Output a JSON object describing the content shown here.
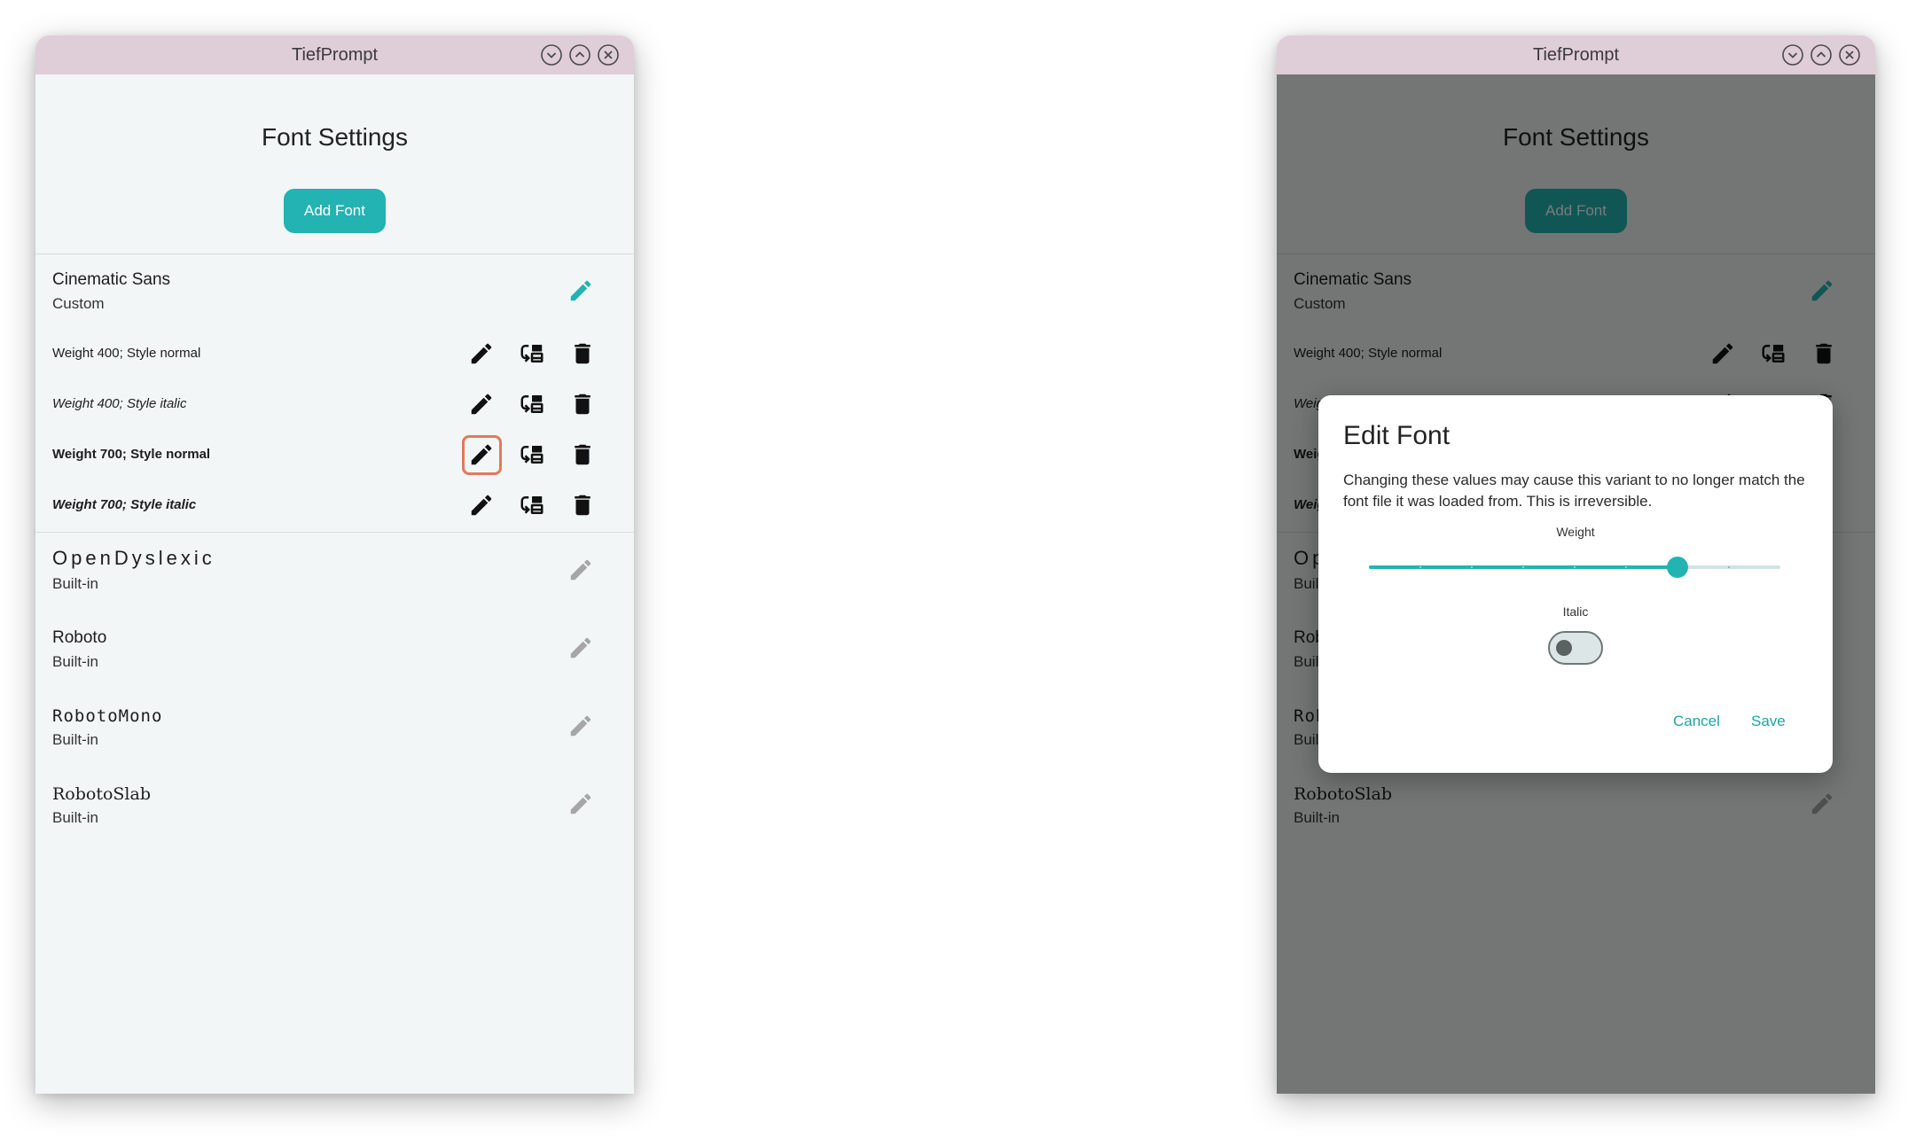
{
  "app_title": "TiefPrompt",
  "page_title": "Font Settings",
  "add_font_label": "Add Font",
  "colors": {
    "accent": "#22b3b2",
    "titlebar": "#dfcdd7",
    "background": "#f2f6f6",
    "focus_ring": "#e07a58",
    "muted_icon": "#a6a6a6"
  },
  "titlebar_buttons": [
    "chevron-down-icon",
    "chevron-up-icon",
    "close-circle-icon"
  ],
  "fonts": [
    {
      "name": "Cinematic Sans",
      "kind": "Custom",
      "edit_icon": "pencil-icon",
      "variants": [
        {
          "label": "Weight 400; Style normal",
          "actions": [
            "pencil-icon",
            "replace-icon",
            "trash-icon"
          ]
        },
        {
          "label": "Weight 400; Style italic",
          "actions": [
            "pencil-icon",
            "replace-icon",
            "trash-icon"
          ]
        },
        {
          "label": "Weight 700; Style normal",
          "actions": [
            "pencil-icon",
            "replace-icon",
            "trash-icon"
          ]
        },
        {
          "label": "Weight 700; Style italic",
          "actions": [
            "pencil-icon",
            "replace-icon",
            "trash-icon"
          ]
        }
      ]
    },
    {
      "name": "OpenDyslexic",
      "kind": "Built-in",
      "edit_icon": "pencil-icon"
    },
    {
      "name": "Roboto",
      "kind": "Built-in",
      "edit_icon": "pencil-icon"
    },
    {
      "name": "RobotoMono",
      "kind": "Built-in",
      "edit_icon": "pencil-icon"
    },
    {
      "name": "RobotoSlab",
      "kind": "Built-in",
      "edit_icon": "pencil-icon"
    }
  ],
  "dialog": {
    "title": "Edit Font",
    "message": "Changing these values may cause this variant to no longer match the font file it was loaded from. This is irreversible.",
    "weight_label": "Weight",
    "weight_value": 700,
    "weight_range": [
      100,
      900
    ],
    "weight_step": 100,
    "italic_label": "Italic",
    "italic_on": false,
    "cancel_label": "Cancel",
    "save_label": "Save"
  }
}
